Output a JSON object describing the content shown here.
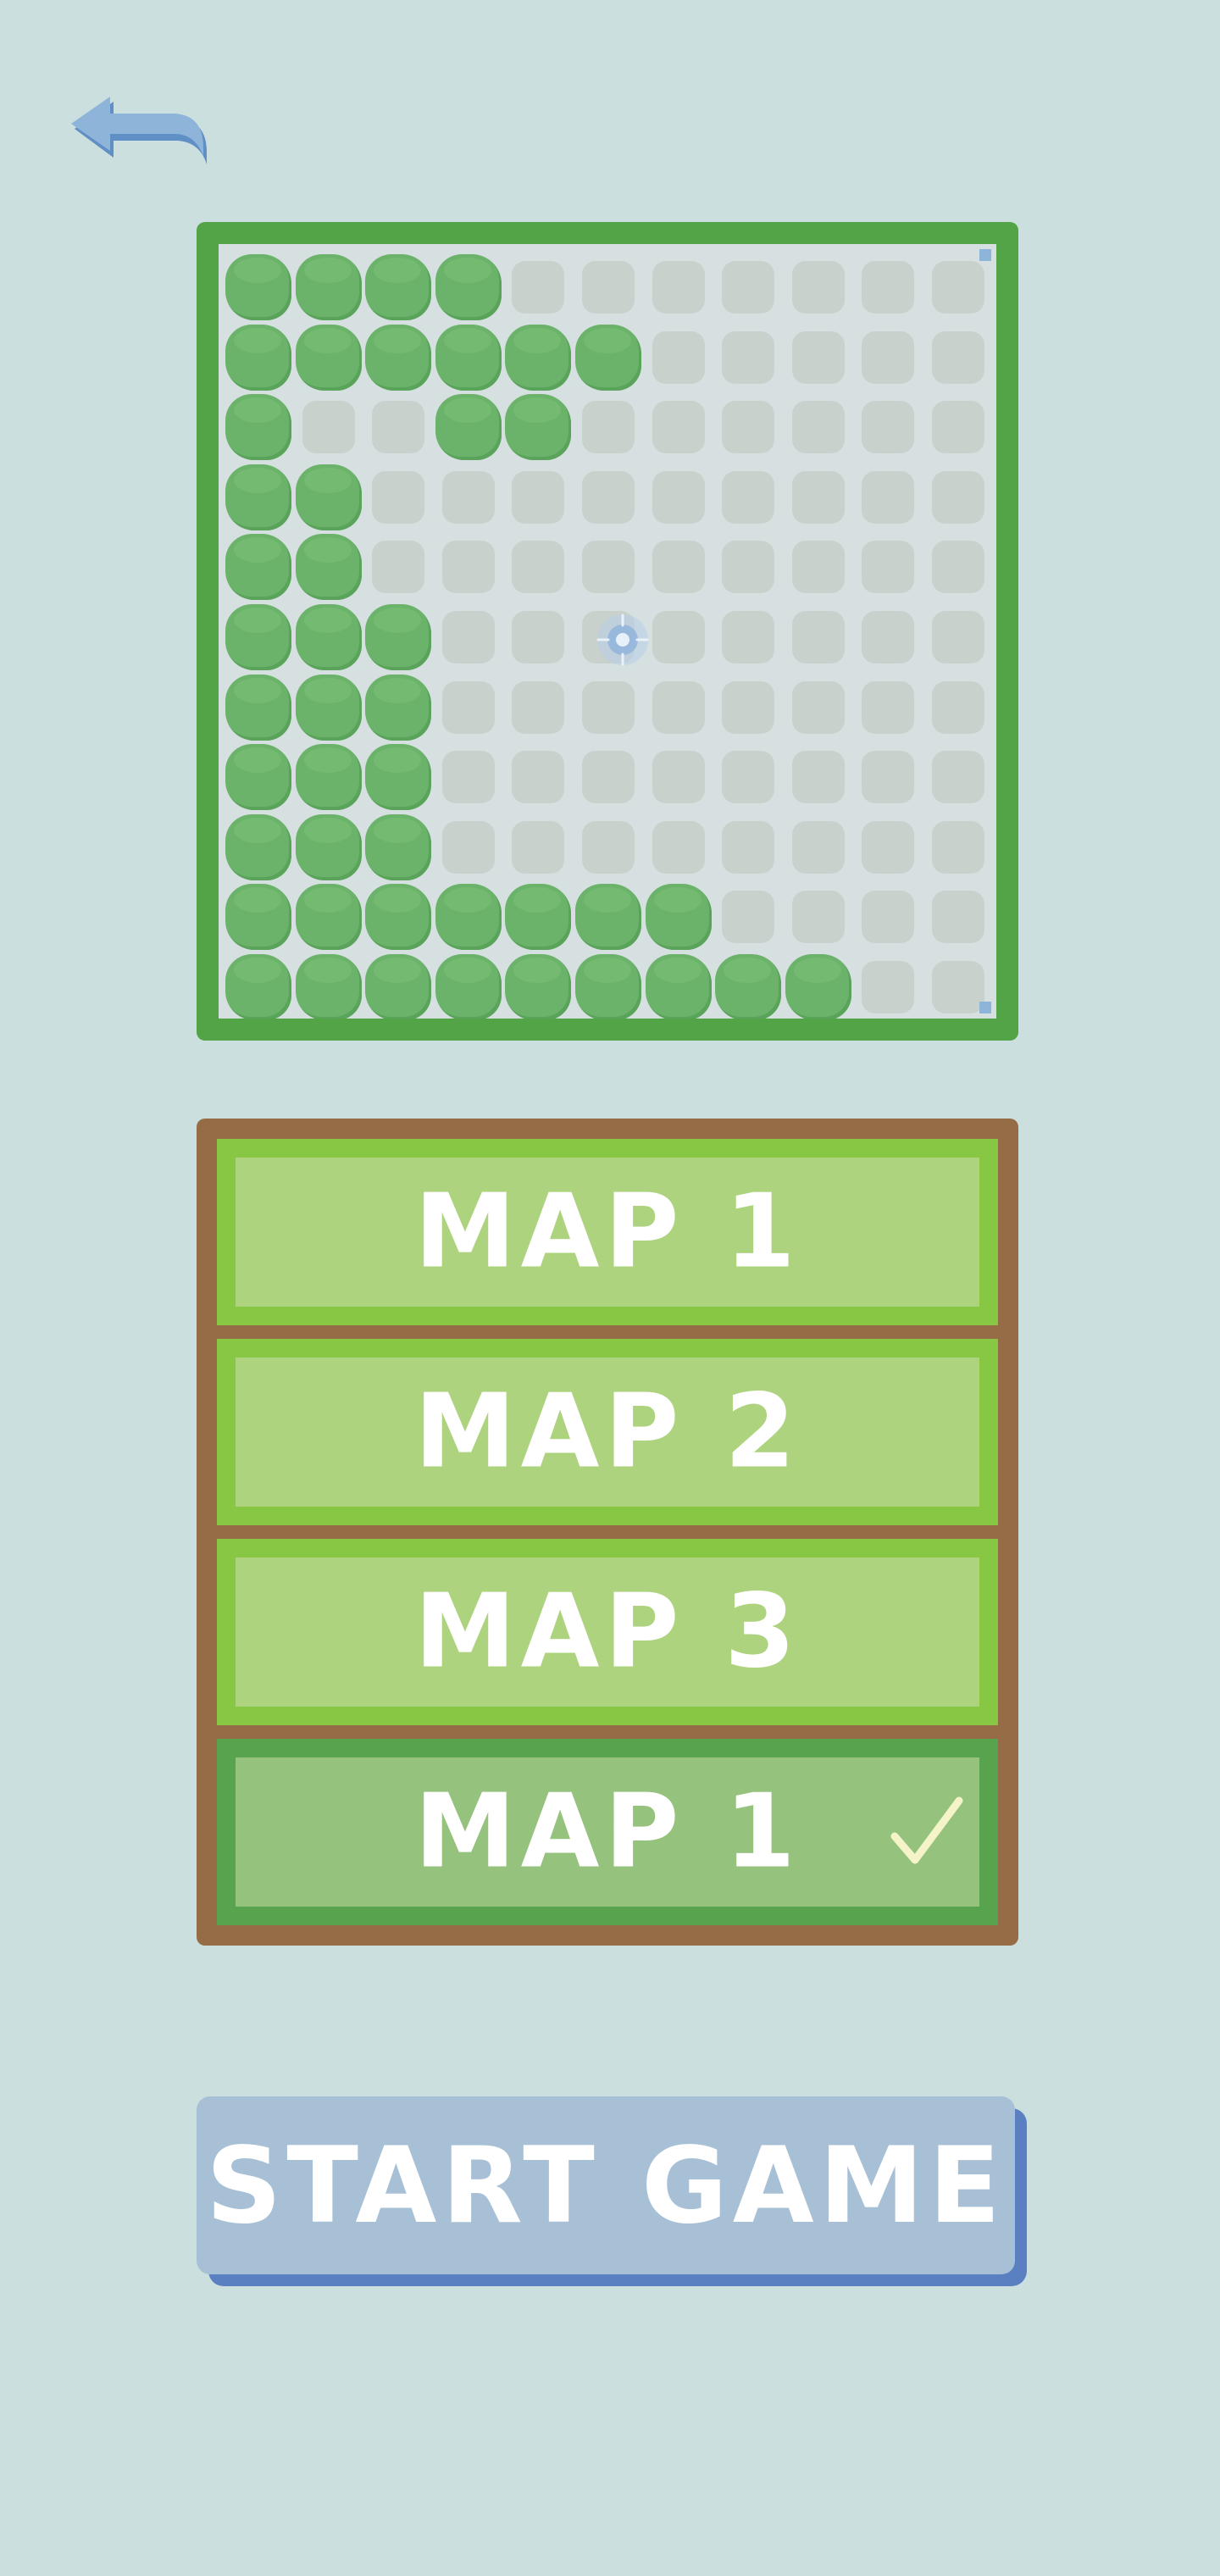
{
  "icons": {
    "back": "back-arrow-icon",
    "spawn": "spawn-point-icon",
    "check": "check-icon"
  },
  "colors": {
    "background": "#cbdfdf",
    "map_border": "#52a447",
    "tree": "#6bb36b",
    "empty_tile": "#c9d1cd",
    "list_frame": "#966c46",
    "map_button": "#aed37f",
    "map_button_selected": "#95c27c",
    "start_button": "#a7c0d6",
    "start_button_shadow": "#5b80c2"
  },
  "map_preview": {
    "rows": [
      "TTTT.......",
      "TTTTTT.....",
      "T..TT......",
      "TT.........",
      "TT.........",
      "TTT........",
      "TTT........",
      "TTT........",
      "TTT........",
      "TTTTTTT....",
      "TTTTTTTTT.."
    ]
  },
  "map_list": {
    "items": [
      {
        "label": "MAP 1",
        "selected": false
      },
      {
        "label": "MAP 2",
        "selected": false
      },
      {
        "label": "MAP 3",
        "selected": false
      },
      {
        "label": "MAP 1",
        "selected": true
      }
    ]
  },
  "start_button": {
    "label": "START GAME"
  }
}
